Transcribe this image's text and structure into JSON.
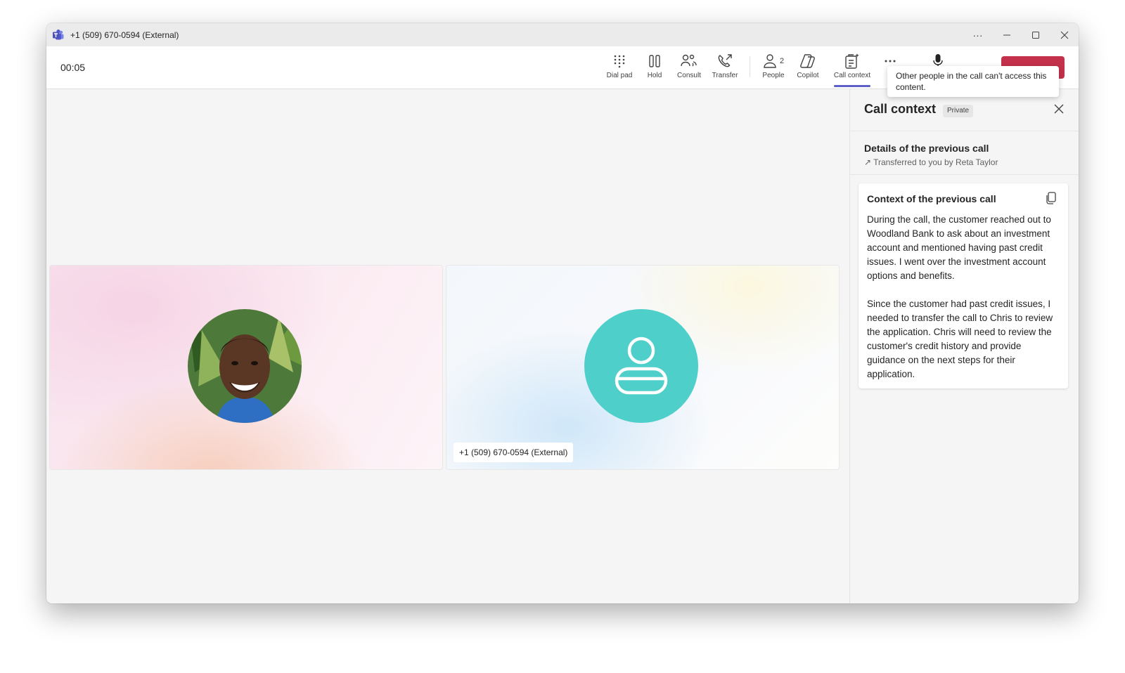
{
  "window": {
    "title": "+1 (509) 670-0594 (External)",
    "app_icon": "teams-icon",
    "controls": [
      "more-icon",
      "minimize-icon",
      "maximize-icon",
      "close-icon"
    ]
  },
  "toolbar": {
    "timer": "00:05",
    "buttons": [
      {
        "label": "Dial pad",
        "icon": "dialpad-icon"
      },
      {
        "label": "Hold",
        "icon": "pause-icon"
      },
      {
        "label": "Consult",
        "icon": "consult-icon"
      },
      {
        "label": "Transfer",
        "icon": "transfer-icon"
      },
      {
        "label": "People",
        "icon": "person-icon",
        "count": "2"
      },
      {
        "label": "Copilot",
        "icon": "copilot-icon"
      },
      {
        "label": "Call context",
        "icon": "call-context-icon",
        "active": true
      },
      {
        "label": "",
        "icon": "more-icon"
      },
      {
        "label": "",
        "icon": "microphone-icon"
      }
    ],
    "leave_label": "Leave",
    "leave_color": "#c4314b",
    "active_color": "#5b5fc7"
  },
  "tooltip": {
    "text": "Other people in the call can't access this content."
  },
  "stage": {
    "participants": [
      {
        "name": "",
        "avatar": "photo"
      },
      {
        "name": "+1 (509) 670-0594 (External)",
        "avatar": "generic-person",
        "avatar_color": "#4ecfca"
      }
    ]
  },
  "panel": {
    "title": "Call context",
    "badge": "Private",
    "details": {
      "title": "Details of the previous call",
      "subtitle": "Transferred to you by Reta Taylor"
    },
    "context": {
      "title": "Context of the previous call",
      "paragraphs": [
        "During the call, the customer reached out to Woodland Bank to ask about an investment account and mentioned having past credit issues. I went over the investment account options and benefits.",
        "Since the customer had past credit issues, I needed to transfer the call to Chris to review the application. Chris will need to review the customer's credit history and provide guidance on the next steps for their application."
      ]
    }
  }
}
